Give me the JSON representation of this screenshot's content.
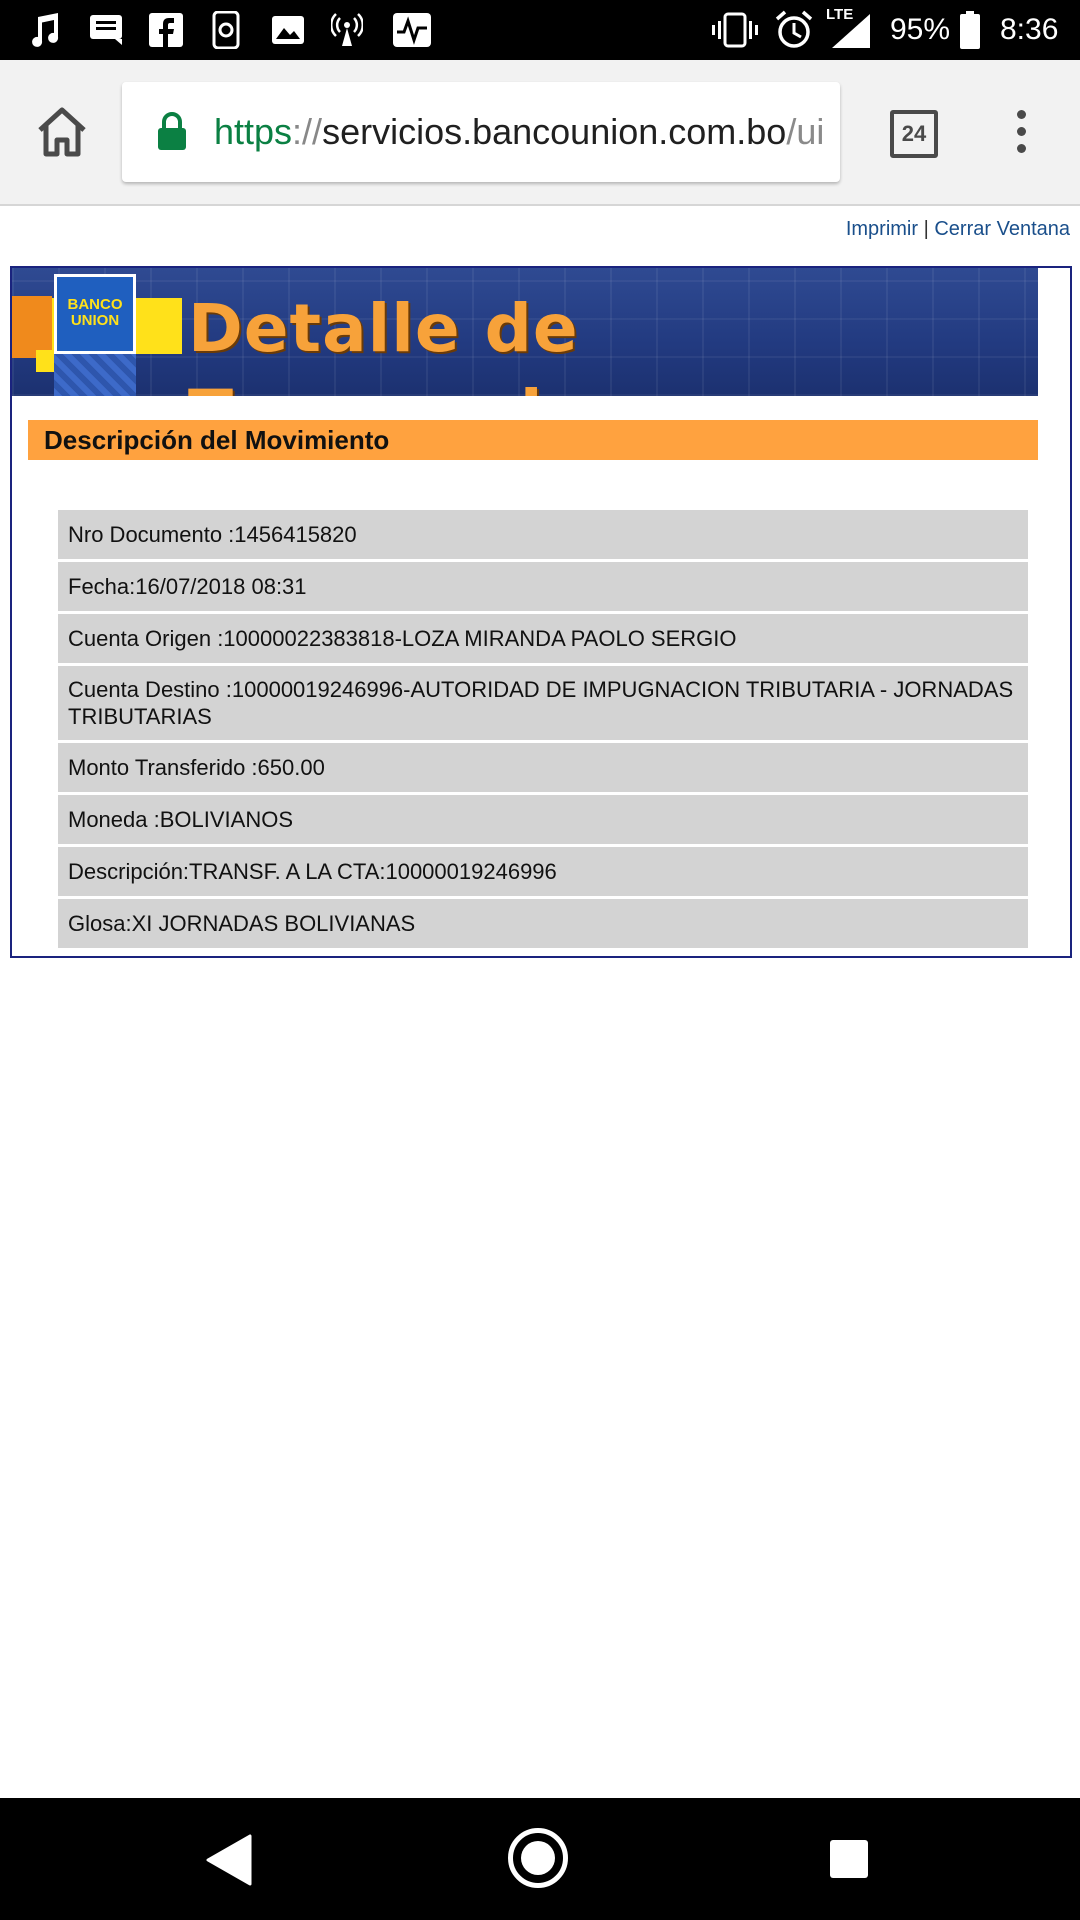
{
  "status_bar": {
    "battery": "95%",
    "time": "8:36",
    "network": "LTE",
    "icons": [
      "music-icon",
      "messages-icon",
      "facebook-icon",
      "app-icon",
      "image-icon",
      "hotspot-icon",
      "activity-icon",
      "vibrate-icon",
      "alarm-icon",
      "signal-icon",
      "battery-icon"
    ]
  },
  "browser": {
    "url_scheme": "https",
    "url_sep": "://",
    "url_host": "servicios.bancounion.com.bo",
    "url_path": "/ui",
    "tab_count": "24"
  },
  "page": {
    "links": {
      "print": "Imprimir",
      "separator": " | ",
      "close": "Cerrar Ventana"
    },
    "banner": {
      "logo_line1": "BANCO",
      "logo_line2": "UNION",
      "title": "Detalle de Transacciones"
    },
    "section_title": "Descripción del Movimiento",
    "details": [
      "Nro Documento :1456415820",
      "Fecha:16/07/2018 08:31",
      "Cuenta Origen :10000022383818-LOZA MIRANDA PAOLO SERGIO",
      "Cuenta Destino :10000019246996-AUTORIDAD DE IMPUGNACION TRIBUTARIA - JORNADAS TRIBUTARIAS",
      "Monto Transferido :650.00",
      "Moneda :BOLIVIANOS",
      "Descripción:TRANSF. A LA CTA:10000019246996",
      "Glosa:XI JORNADAS BOLIVIANAS"
    ]
  },
  "colors": {
    "accent_orange": "#ffa23f",
    "banner_blue": "#223a80",
    "row_grey": "#d3d3d3",
    "link_blue": "#1a4f8b",
    "secure_green": "#0b8043"
  }
}
